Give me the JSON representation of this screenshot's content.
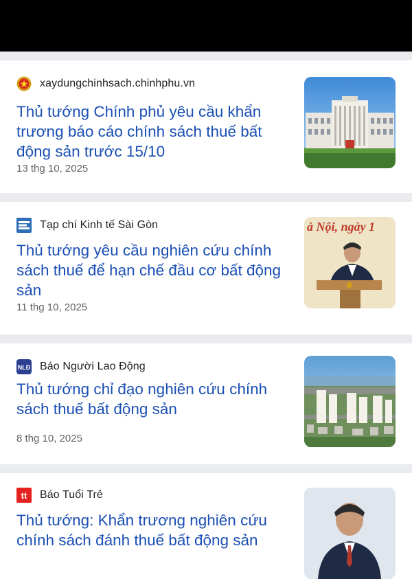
{
  "articles": [
    {
      "source": "xaydungchinhsach.chinhphu.vn",
      "source_icon": "vietnam-emblem-icon",
      "title": "Thủ tướng Chính phủ yêu cầu khẩn trương báo cáo chính sách thuế bất động sản trước 15/10",
      "date": "13 thg 10, 2025",
      "thumbnail": "government-building-image"
    },
    {
      "source": "Tạp chí Kinh tế Sài Gòn",
      "source_icon": "ktsg-logo-icon",
      "title": "Thủ tướng yêu cầu nghiên cứu chính sách thuế để hạn chế đầu cơ bất động sản",
      "date": "11 thg 10, 2025",
      "thumbnail": "speaker-at-podium-image",
      "thumbnail_text": "à Nội, ngày 1"
    },
    {
      "source": "Báo Người Lao Động",
      "source_icon": "nld-logo-icon",
      "title": "Thủ tướng chỉ đạo nghiên cứu chính sách thuế bất động sản",
      "date": "8 thg 10, 2025",
      "thumbnail": "city-skyline-image"
    },
    {
      "source": "Báo Tuổi Trẻ",
      "source_icon": "tuoitre-logo-icon",
      "title": "Thủ tướng: Khẩn trương nghiên cứu chính sách đánh thuế bất động sản",
      "date": "",
      "thumbnail": "portrait-image"
    }
  ],
  "colors": {
    "title": "#1a4fb4",
    "separator": "#e9ebef",
    "date": "#5f6368"
  }
}
